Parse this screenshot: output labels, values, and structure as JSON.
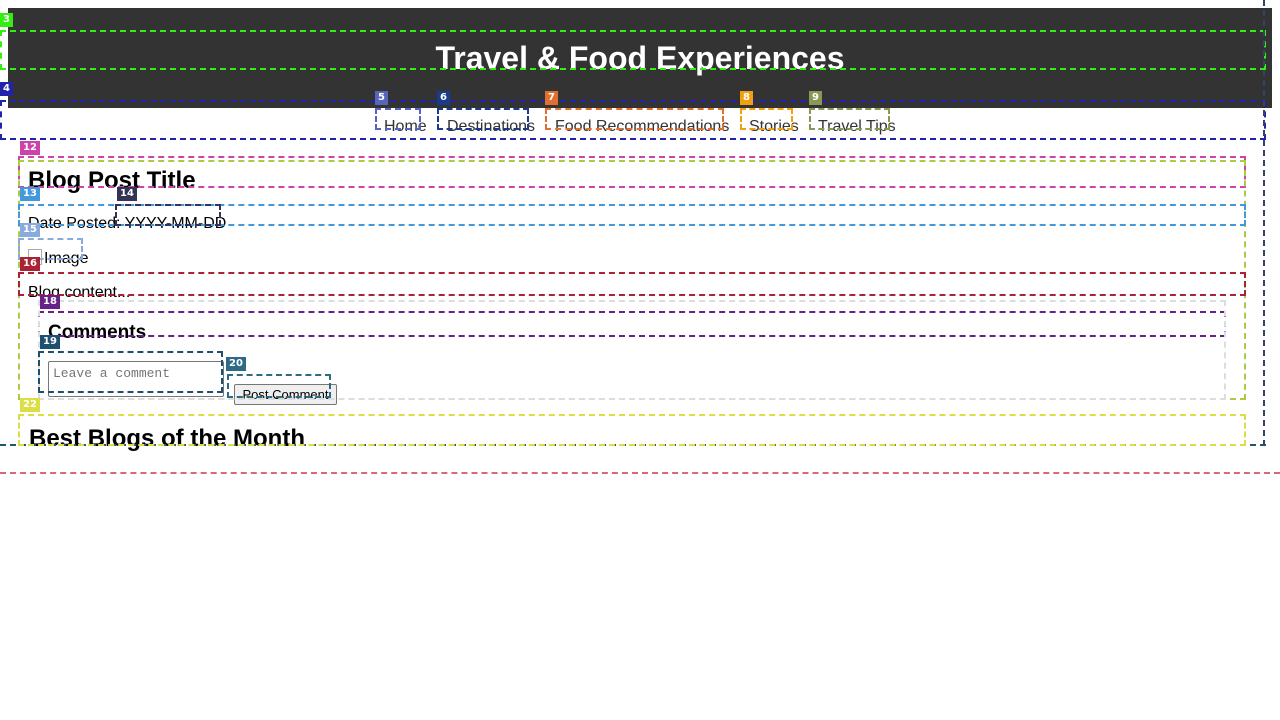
{
  "header": {
    "title": "Travel & Food Experiences"
  },
  "nav": {
    "items": [
      {
        "label": "Home"
      },
      {
        "label": "Destinations"
      },
      {
        "label": "Food Recommendations"
      },
      {
        "label": "Stories"
      },
      {
        "label": "Travel Tips"
      }
    ]
  },
  "post": {
    "title": "Blog Post Title",
    "date_label": "Date Posted: ",
    "date_value": "YYYY-MM-DD",
    "image_alt": "Image",
    "content": "Blog content..."
  },
  "comments": {
    "heading": "Comments",
    "placeholder": "Leave a comment",
    "submit_label": "Post Comment"
  },
  "sidebar": {
    "heading": "Best Blogs of the Month"
  },
  "overlay_labels": [
    "3",
    "4",
    "5",
    "6",
    "7",
    "8",
    "9",
    "12",
    "13",
    "14",
    "15",
    "16",
    "18",
    "19",
    "20",
    "22"
  ],
  "colors": {
    "header_bg": "#333333",
    "header_text": "#ffffff",
    "nav_text": "#333333"
  }
}
